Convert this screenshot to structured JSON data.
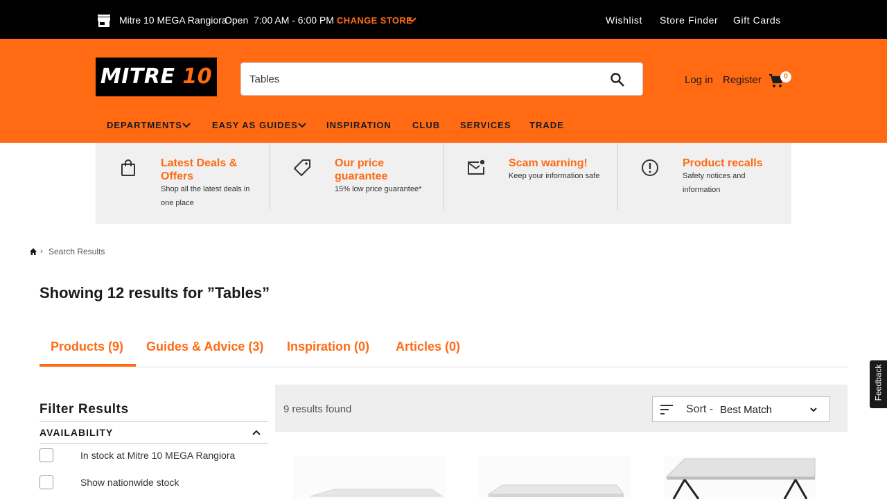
{
  "topbar": {
    "store_name": "Mitre 10 MEGA Rangiora",
    "status": "Open",
    "hours": "7:00 AM - 6:00 PM",
    "change_store": "CHANGE STORE",
    "links": [
      "Wishlist",
      "Store Finder",
      "Gift Cards"
    ]
  },
  "header": {
    "logo": "MITRE 10",
    "search_value": "Tables",
    "login": "Log in",
    "register": "Register",
    "cart_count": "0",
    "nav": [
      "DEPARTMENTS",
      "EASY AS GUIDES",
      "INSPIRATION",
      "CLUB",
      "SERVICES",
      "TRADE"
    ]
  },
  "promos": [
    {
      "title": "Latest Deals & Offers",
      "subtitle": "Shop all the latest deals in one place",
      "icon": "shopping-bag-icon"
    },
    {
      "title": "Our price guarantee",
      "subtitle": "15% low price guarantee*",
      "icon": "price-tag-icon"
    },
    {
      "title": "Scam warning!",
      "subtitle": "Keep your information safe",
      "icon": "mail-alert-icon"
    },
    {
      "title": "Product recalls",
      "subtitle": "Safety notices and information",
      "icon": "alert-circle-icon"
    }
  ],
  "breadcrumb": {
    "separator": "›",
    "current": "Search Results"
  },
  "results_title": "Showing 12 results for ”Tables”",
  "tabs": [
    "Products (9)",
    "Guides & Advice (3)",
    "Inspiration (0)",
    "Articles (0)"
  ],
  "filters": {
    "title": "Filter Results",
    "availability": "AVAILABILITY",
    "options": [
      "In stock at Mitre 10 MEGA Rangiora",
      "Show nationwide stock"
    ]
  },
  "results_bar": {
    "count": "9 results found",
    "sort_label": "Sort -",
    "sort_value": "Best Match"
  },
  "feedback": "Feedback",
  "colors": {
    "brand_orange": "#ff6a13",
    "topbar": "#000000",
    "promo_bg": "#f0f0f0"
  }
}
